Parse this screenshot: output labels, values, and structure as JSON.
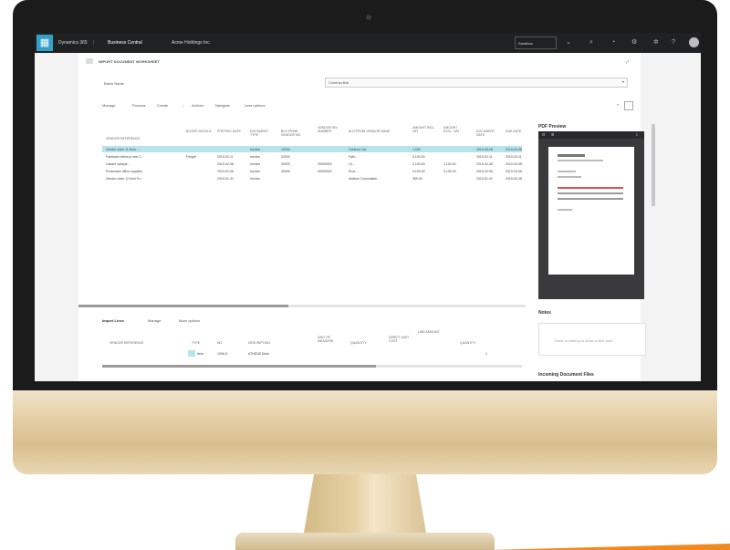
{
  "app": {
    "product": "Dynamics 365",
    "module": "Business Central",
    "company": "Acme Holdings Inc.",
    "environment": "Sandbox"
  },
  "page": {
    "title": "IMPORT DOCUMENT WORKSHEET",
    "vendor_label": "Batch Name",
    "vendor_value": "Continia Bat.",
    "actions": [
      "Manage",
      "Process",
      "Create",
      "|",
      "Actions",
      "Navigate",
      "Less options"
    ]
  },
  "table": {
    "columns": [
      "VENDOR REFERENCE",
      "BUYER VAT/GLN",
      "POSTING DATE",
      "DOCUMENT TYPE",
      "BUY-FROM VENDOR NO.",
      "VENDOR INV. NUMBER",
      "BUY-FROM VENDOR NAME",
      "AMOUNT INCL. VAT",
      "AMOUNT EXCL. VAT",
      "DOCUMENT DATE",
      "DUE DATE"
    ],
    "rows": [
      [
        "Vendor order 11 from ...",
        "",
        "",
        "Invoice",
        "10000",
        "",
        "Contoso Ltd.",
        "1,000",
        "",
        "2019-03-08",
        "2019-04-08"
      ],
      [
        "Fabrikam delivery note 2...",
        "Freight",
        "2019-02-11",
        "Invoice",
        "20000",
        "",
        "Fabr...",
        "3,100.00",
        "",
        "2019-02-11",
        "2019-03-11"
      ],
      [
        "Litware sample...",
        "",
        "2019-02-08",
        "Invoice",
        "30000",
        "20000000",
        "Lit...",
        "3,100.00",
        "3,100.00",
        "2019-02-08",
        "2019-03-08"
      ],
      [
        "Proseware office supplies",
        "",
        "2019-02-06",
        "Invoice",
        "40000",
        "20000002",
        "Pros...",
        "3,100.00",
        "3,100.00",
        "2019-02-06",
        "2019-03-06"
      ],
      [
        "Vendor order 12 from Fo...",
        "",
        "2019-01-31",
        "Invoice",
        "",
        "",
        "Adatum Corporation ...",
        "350.00",
        "",
        "2019-01-31",
        "2019-02-28"
      ]
    ]
  },
  "lines": {
    "tabs": [
      "Import Lines",
      "Manage",
      "More options"
    ],
    "columns": [
      "VENDOR REFERENCE",
      "TYPE",
      "NO.",
      "DESCRIPTION",
      "UNIT OF MEASURE",
      "QUANTITY",
      "DIRECT UNIT COST",
      "LINE AMOUNT",
      "QUANTITY"
    ],
    "rows": [
      [
        "",
        "Item",
        "1996-S",
        "ATHENS Desk",
        "",
        "",
        "",
        "",
        "1"
      ]
    ]
  },
  "side": {
    "pdf_title": "PDF Preview",
    "notes_title": "Notes",
    "notes_hint": "There is nothing to show in this view",
    "incoming_title": "Incoming Document Files"
  },
  "colors": {
    "accent": "#33a0c8",
    "selection": "#b6e3ec",
    "topbar": "#202123"
  }
}
